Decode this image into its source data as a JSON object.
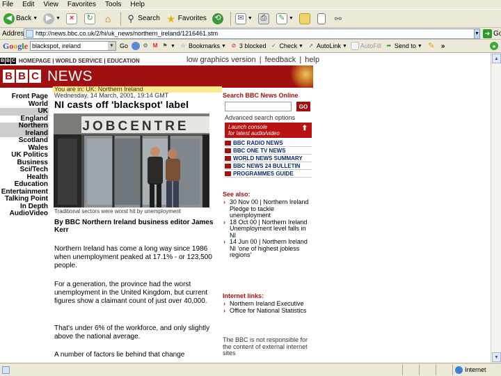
{
  "browser": {
    "menu": [
      "File",
      "Edit",
      "View",
      "Favorites",
      "Tools",
      "Help"
    ],
    "toolbar": {
      "back": "Back",
      "search": "Search",
      "favorites": "Favorites"
    },
    "address": {
      "label": "Address",
      "url": "http://news.bbc.co.uk/2/hi/uk_news/northern_ireland/1216461.stm",
      "go": "Go"
    },
    "google": {
      "query": "blackspot, ireland",
      "go": "Go",
      "bookmarks": "Bookmarks",
      "blocked": "3 blocked",
      "check": "Check",
      "autolink": "AutoLink",
      "autofill": "AutoFill",
      "sendto": "Send to"
    },
    "status": {
      "zone": "Internet"
    }
  },
  "page": {
    "topbar": {
      "logo": [
        "B",
        "B",
        "C"
      ],
      "links": "HOMEPAGE | WORLD SERVICE | EDUCATION"
    },
    "utility": [
      "low graphics version",
      "|",
      "feedback",
      "|",
      "help"
    ],
    "banner": {
      "blocks": [
        "B",
        "B",
        "C"
      ],
      "title": "NEWS"
    },
    "nav": [
      {
        "label": "Front Page",
        "style": ""
      },
      {
        "label": "World",
        "style": ""
      },
      {
        "label": "UK",
        "style": "sel"
      },
      {
        "label": "England",
        "style": "sub"
      },
      {
        "label": "Northern",
        "style": "subsel"
      },
      {
        "label": "Ireland",
        "style": "subsel"
      },
      {
        "label": "Scotland",
        "style": "sub"
      },
      {
        "label": "Wales",
        "style": "sub"
      },
      {
        "label": "UK Politics",
        "style": ""
      },
      {
        "label": "Business",
        "style": ""
      },
      {
        "label": "Sci/Tech",
        "style": ""
      },
      {
        "label": "Health",
        "style": ""
      },
      {
        "label": "Education",
        "style": ""
      },
      {
        "label": "Entertainment",
        "style": ""
      },
      {
        "label": "Talking Point",
        "style": ""
      },
      {
        "label": "In Depth",
        "style": ""
      },
      {
        "label": "AudioVideo",
        "style": ""
      }
    ],
    "article": {
      "crumb": "You are in: UK: Northern Ireland",
      "date": "Wednesday, 14 March, 2001, 19:14 GMT",
      "headline": "NI casts off 'blackspot' label",
      "photo_sign": "JOBCENTRE",
      "caption": "Traditional sectors were worst hit by unemployment",
      "byline": "By BBC Northern Ireland business editor James Kerr",
      "paragraphs": [
        "Northern Ireland has come a long way since 1986 when unemployment peaked at 17.1% - or 123,500 people.",
        "For a generation, the province had the worst unemployment in the United Kingdom, but current figures show a claimant count of just over 40,000.",
        "That's under 6% of the workforce, and only slightly above the national average.",
        "A number of factors lie behind that change"
      ]
    },
    "sidebar": {
      "search_label": "Search BBC News Online",
      "search_go": "GO",
      "advanced": "Advanced search options",
      "launch": [
        "Launch console",
        "for latest audio/video"
      ],
      "av_links": [
        "BBC RADIO NEWS",
        "BBC ONE TV NEWS",
        "WORLD NEWS SUMMARY",
        "BBC NEWS 24 BULLETIN",
        "PROGRAMMES GUIDE"
      ],
      "see_also_label": "See also:",
      "see_also": [
        {
          "date": "30 Nov 00 | Northern Ireland",
          "title": "Pledge to tackle unemployment"
        },
        {
          "date": "18 Oct 00 | Northern Ireland",
          "title": "Unemployment level falls in NI"
        },
        {
          "date": "14 Jun 00 | Northern Ireland",
          "title": "NI 'one of highest jobless regions'"
        }
      ],
      "internet_label": "Internet links:",
      "internet": [
        "Northern Ireland Executive",
        "Office for National Statistics"
      ],
      "disclaimer": "The BBC is not responsible for the content of external internet sites"
    }
  }
}
